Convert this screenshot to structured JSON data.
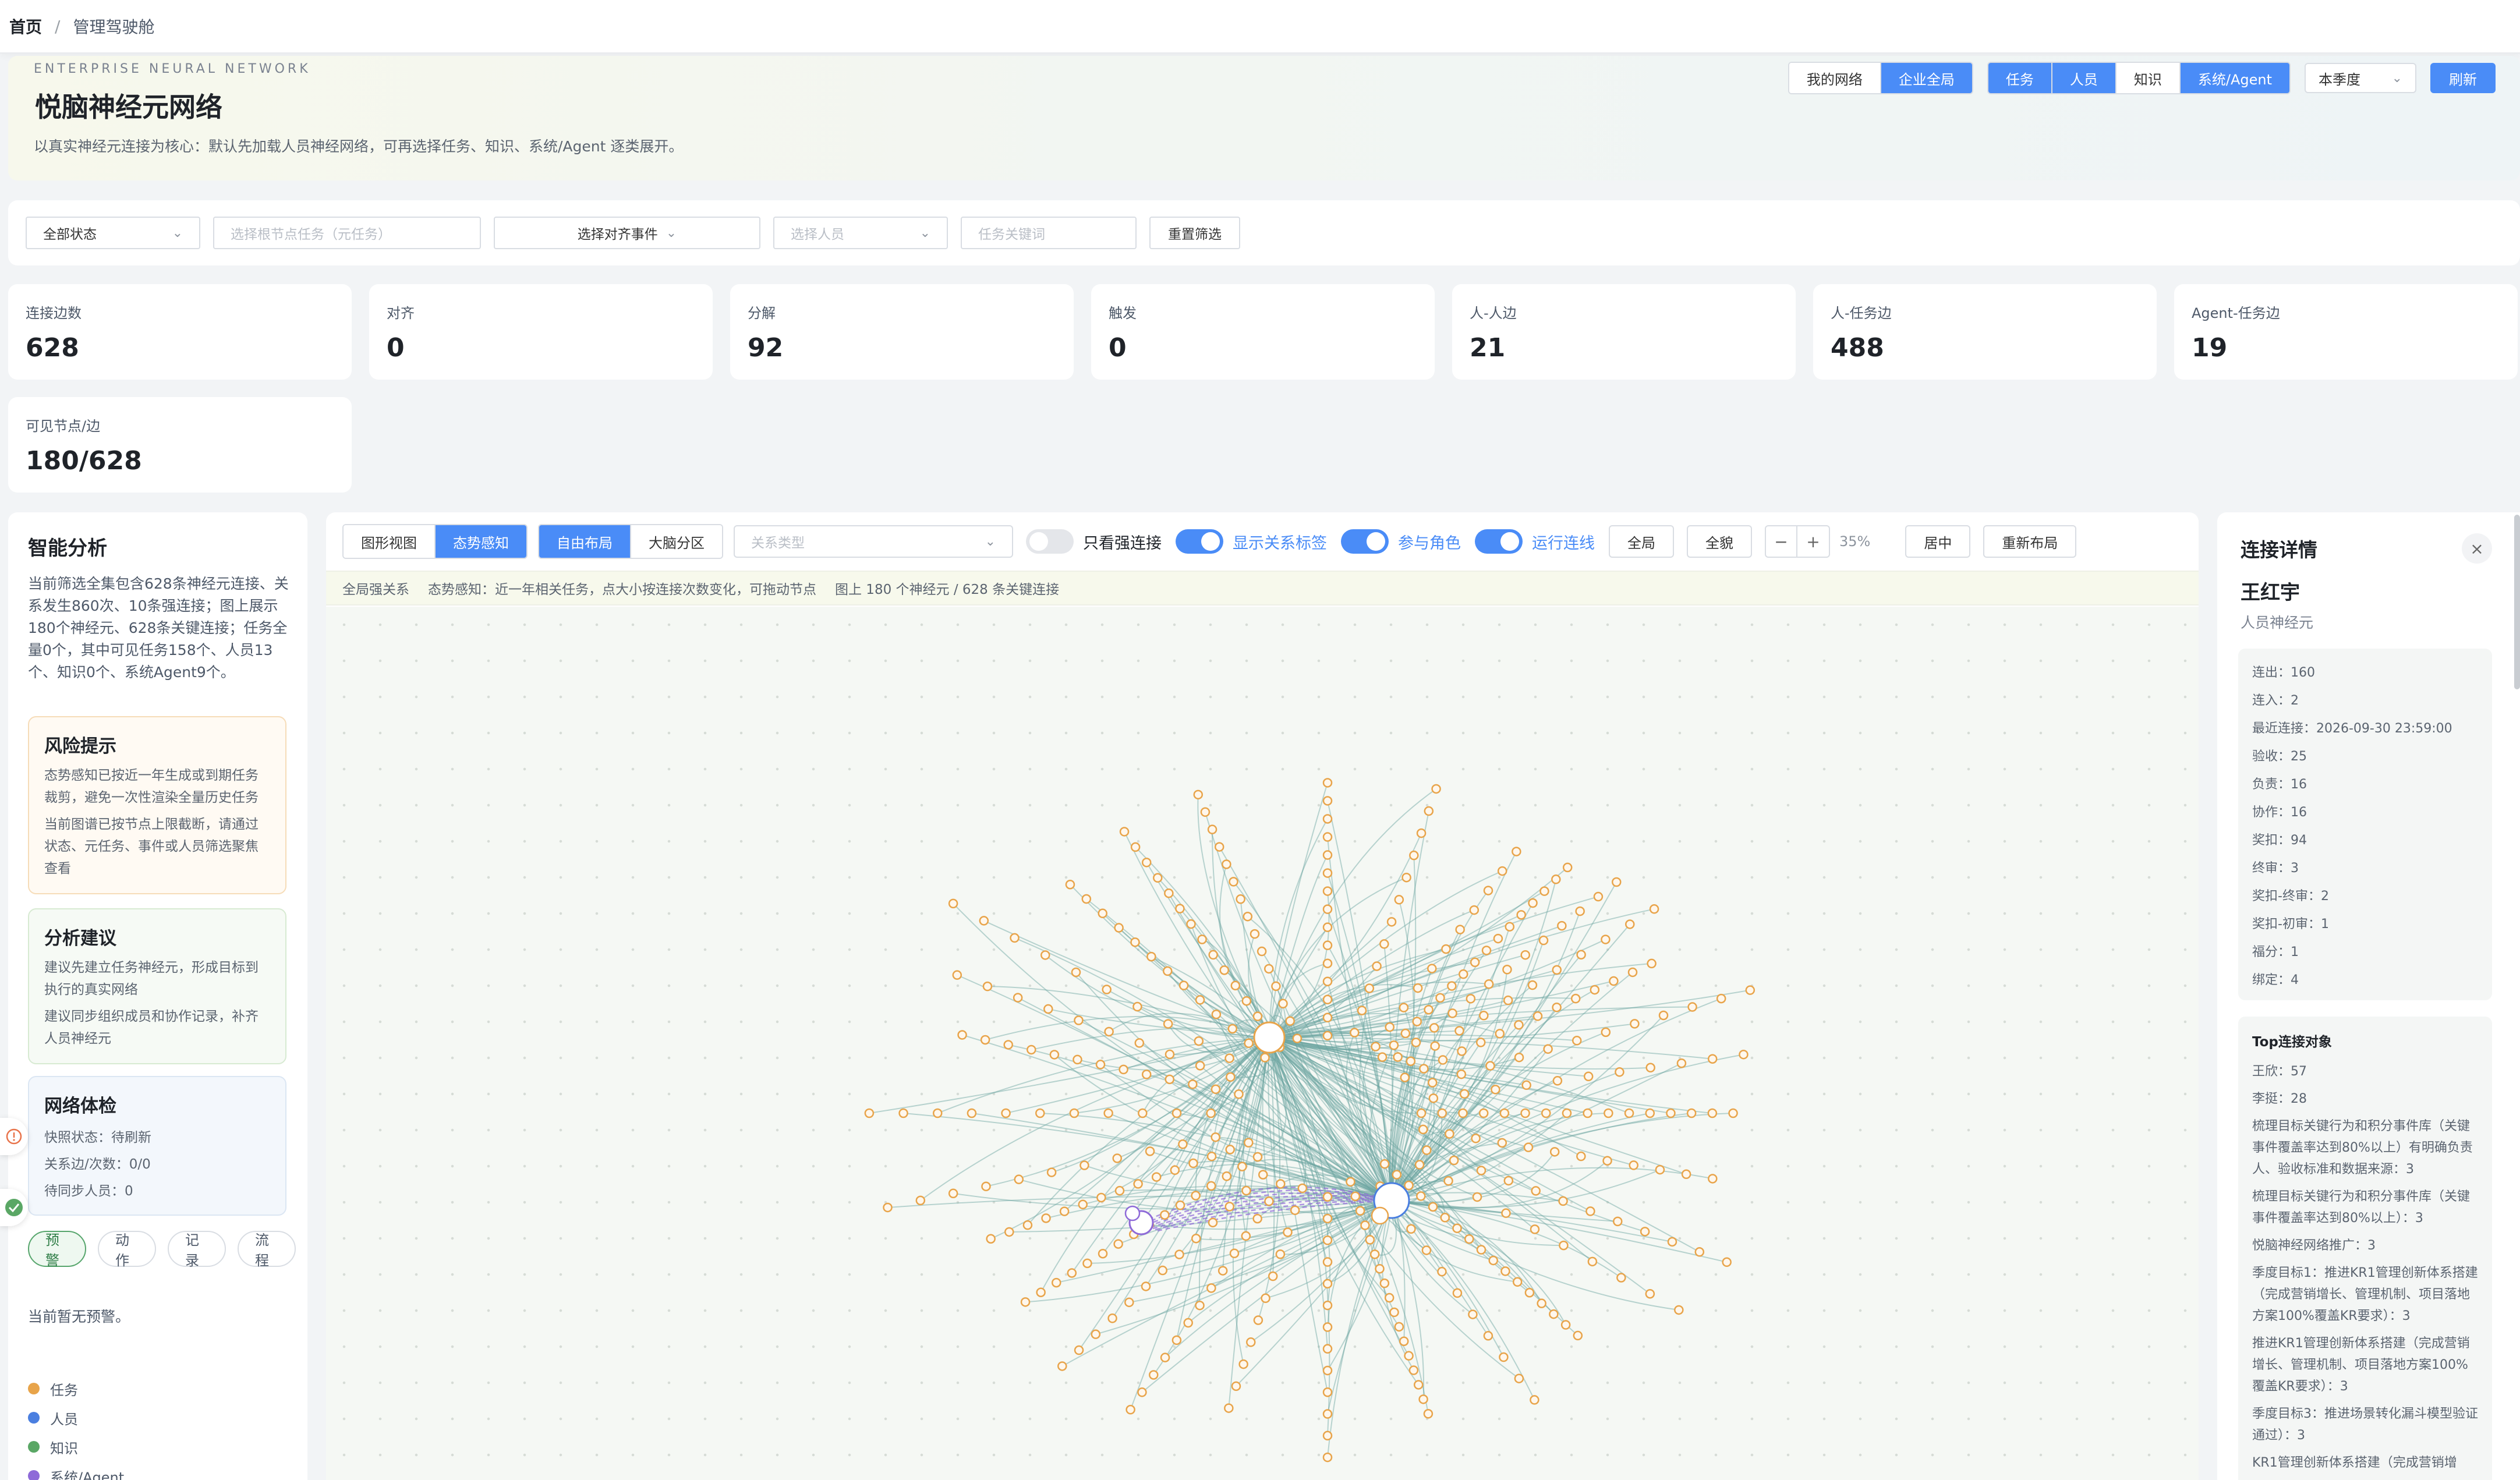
{
  "breadcrumb": {
    "home": "首页",
    "sep": "/",
    "current": "管理驾驶舱"
  },
  "hero": {
    "eyebrow": "ENTERPRISE NEURAL NETWORK",
    "title": "悦脑神经元网络",
    "desc": "以真实神经元连接为核心：默认先加载人员神经网络，可再选择任务、知识、系统/Agent 逐类展开。",
    "scope": [
      {
        "label": "我的网络",
        "active": false
      },
      {
        "label": "企业全局",
        "active": true
      }
    ],
    "layers": [
      {
        "label": "任务",
        "active": true
      },
      {
        "label": "人员",
        "active": true
      },
      {
        "label": "知识",
        "active": false
      },
      {
        "label": "系统/Agent",
        "active": true
      }
    ],
    "period": "本季度",
    "refresh": "刷新"
  },
  "filters": {
    "status": "全部状态",
    "root_task_placeholder": "选择根节点任务（元任务）",
    "align_event": "选择对齐事件",
    "person_placeholder": "选择人员",
    "keyword_placeholder": "任务关键词",
    "reset": "重置筛选"
  },
  "stats": [
    {
      "label": "连接边数",
      "value": "628"
    },
    {
      "label": "对齐",
      "value": "0"
    },
    {
      "label": "分解",
      "value": "92"
    },
    {
      "label": "触发",
      "value": "0"
    },
    {
      "label": "人-人边",
      "value": "21"
    },
    {
      "label": "人-任务边",
      "value": "488"
    },
    {
      "label": "Agent-任务边",
      "value": "19"
    },
    {
      "label": "可见节点/边",
      "value": "180/628"
    }
  ],
  "analysis": {
    "title": "智能分析",
    "summary": "当前筛选全集包含628条神经元连接、关系发生860次、10条强连接；图上展示180个神经元、628条关键连接；任务全量0个，其中可见任务158个、人员13个、知识0个、系统Agent9个。",
    "risk": {
      "title": "风险提示",
      "lines": [
        "态势感知已按近一年生成或到期任务裁剪，避免一次性渲染全量历史任务",
        "当前图谱已按节点上限截断，请通过状态、元任务、事件或人员筛选聚焦查看"
      ]
    },
    "advice": {
      "title": "分析建议",
      "lines": [
        "建议先建立任务神经元，形成目标到执行的真实网络",
        "建议同步组织成员和协作记录，补齐人员神经元"
      ]
    },
    "health": {
      "title": "网络体检",
      "lines": [
        "快照状态：待刷新",
        "关系边/次数：0/0",
        "待同步人员：0"
      ]
    },
    "tabs": [
      {
        "label": "预警",
        "active": true
      },
      {
        "label": "动作",
        "active": false
      },
      {
        "label": "记录",
        "active": false
      },
      {
        "label": "流程",
        "active": false
      }
    ],
    "no_alert": "当前暂无预警。",
    "legend": [
      {
        "label": "任务",
        "color": "#e8a44a"
      },
      {
        "label": "人员",
        "color": "#4a7fe0"
      },
      {
        "label": "知识",
        "color": "#5aa765"
      },
      {
        "label": "系统/Agent",
        "color": "#8e6ad8"
      }
    ]
  },
  "graph_toolbar": {
    "views": [
      {
        "label": "图形视图",
        "active": false
      },
      {
        "label": "态势感知",
        "active": true
      }
    ],
    "layouts": [
      {
        "label": "自由布局",
        "active": true
      },
      {
        "label": "大脑分区",
        "active": false
      }
    ],
    "rel_type_placeholder": "关系类型",
    "toggles": [
      {
        "label": "只看强连接",
        "on": false
      },
      {
        "label": "显示关系标签",
        "on": true
      },
      {
        "label": "参与角色",
        "on": true
      },
      {
        "label": "运行连线",
        "on": true
      }
    ],
    "global": "全局",
    "panorama": "全貌",
    "zoom_minus": "−",
    "zoom_plus": "+",
    "zoom": "35%",
    "center": "居中",
    "relayout": "重新布局",
    "info": [
      "全局强关系",
      "态势感知：近一年相关任务，点大小按连接次数变化，可拖动节点",
      "图上 180 个神经元 / 628 条关键连接"
    ]
  },
  "colors": {
    "accent": "#4a8cf7",
    "task": "#e8a44a",
    "person": "#4a7fe0",
    "agent": "#8e6ad8",
    "edge": "#6aa3a0"
  },
  "detail": {
    "title": "连接详情",
    "close": "×",
    "name": "王红宇",
    "type": "人员神经元",
    "stats": [
      "连出：160",
      "连入：2",
      "最近连接：2026-09-30 23:59:00",
      "验收：25",
      "负责：16",
      "协作：16",
      "奖扣：94",
      "终审：3",
      "奖扣-终审：2",
      "奖扣-初审：1",
      "福分：1",
      "绑定：4"
    ],
    "top_title": "Top连接对象",
    "top": [
      "王欣：57",
      "李挺：28",
      "梳理目标关键行为和积分事件库（关键事件覆盖率达到80%以上）有明确负责人、验收标准和数据来源：3",
      "梳理目标关键行为和积分事件库（关键事件覆盖率达到80%以上）：3",
      "悦脑神经网络推广：3",
      "季度目标1：推进KR1管理创新体系搭建（完成营销增长、管理机制、项目落地方案100%覆盖KR要求）：3",
      "推进KR1管理创新体系搭建（完成营销增长、管理机制、项目落地方案100%覆盖KR要求）：3",
      "季度目标3：推进场景转化漏斗模型验证通过）：3",
      "KR1管理创新体系搭建（完成营销增"
    ]
  }
}
